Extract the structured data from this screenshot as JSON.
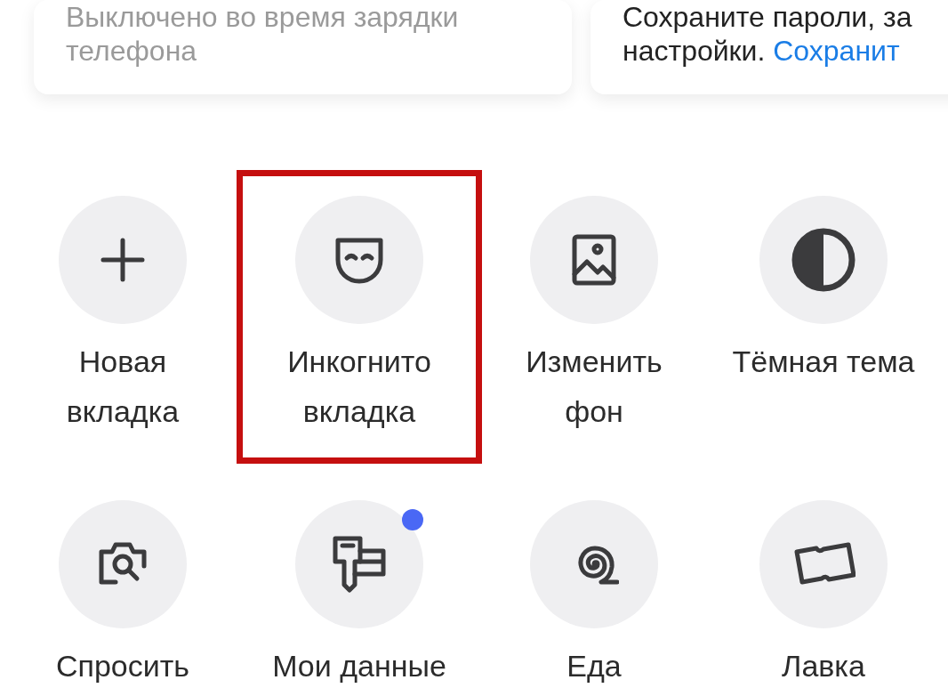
{
  "cards": [
    {
      "kind": "muted",
      "lines": [
        "Выключено во время зарядки",
        "телефона"
      ]
    },
    {
      "kind": "promo",
      "lines": [
        "Сохраните пароли, за",
        "настройки."
      ],
      "link": "Сохранит"
    }
  ],
  "actions": [
    {
      "label": [
        "Новая",
        "вкладка"
      ],
      "highlighted": false,
      "badge": false
    },
    {
      "label": [
        "Инкогнито",
        "вкладка"
      ],
      "highlighted": true,
      "badge": false
    },
    {
      "label": [
        "Изменить",
        "фон"
      ],
      "highlighted": false,
      "badge": false
    },
    {
      "label": [
        "Тёмная тема"
      ],
      "highlighted": false,
      "badge": false
    },
    {
      "label": [
        "Спросить"
      ],
      "highlighted": false,
      "badge": false
    },
    {
      "label": [
        "Мои данные"
      ],
      "highlighted": false,
      "badge": true
    },
    {
      "label": [
        "Еда"
      ],
      "highlighted": false,
      "badge": false
    },
    {
      "label": [
        "Лавка"
      ],
      "highlighted": false,
      "badge": false
    }
  ]
}
